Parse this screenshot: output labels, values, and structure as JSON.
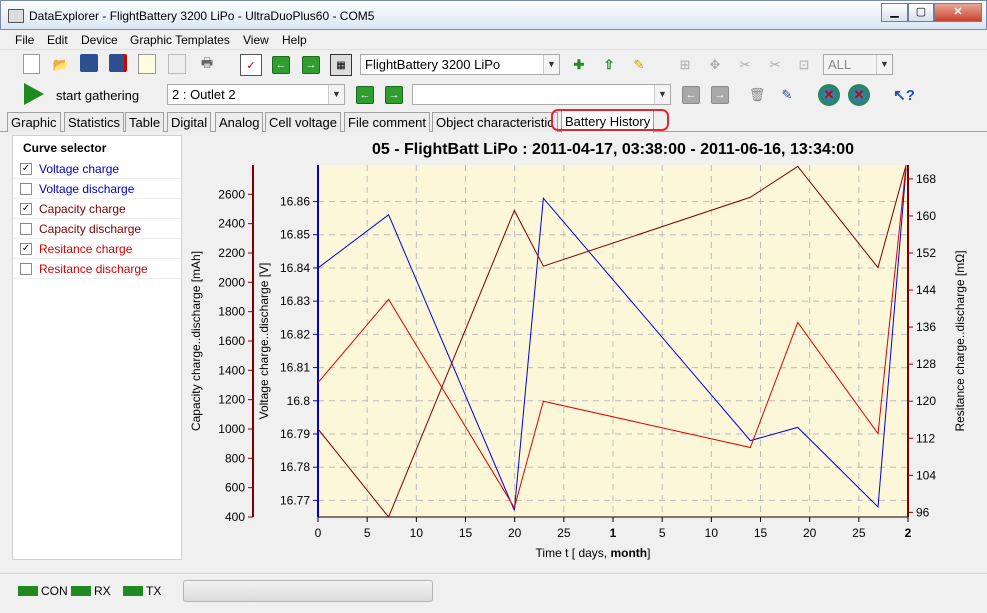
{
  "window": {
    "title": "DataExplorer  -  FlightBattery 3200 LiPo  -  UltraDuoPlus60  -  COM5"
  },
  "menu": [
    "File",
    "Edit",
    "Device",
    "Graphic Templates",
    "View",
    "Help"
  ],
  "toolbar": {
    "device_config": "FlightBattery 3200 LiPo",
    "filter": "ALL",
    "start_label": "start gathering",
    "outlet": "2 : Outlet 2",
    "record": ""
  },
  "tabs": [
    "Graphic",
    "Statistics",
    "Table",
    "Digital",
    "Analog",
    "Cell voltage",
    "File comment",
    "Object characteristic",
    "Battery History"
  ],
  "active_tab": "Battery History",
  "curve_selector": {
    "title": "Curve selector",
    "items": [
      {
        "label": "Voltage charge",
        "checked": true,
        "color": "#0000c8"
      },
      {
        "label": "Voltage discharge",
        "checked": false,
        "color": "#0000c8"
      },
      {
        "label": "Capacity charge",
        "checked": true,
        "color": "#800000"
      },
      {
        "label": "Capacity discharge",
        "checked": false,
        "color": "#800000"
      },
      {
        "label": "Resitance charge",
        "checked": true,
        "color": "#d40000"
      },
      {
        "label": "Resitance discharge",
        "checked": false,
        "color": "#d40000"
      }
    ]
  },
  "status": {
    "con": "CON",
    "rx": "RX",
    "tx": "TX"
  },
  "chart_data": {
    "type": "line",
    "title": "05 - FlightBatt LiPo : 2011-04-17, 03:38:00 - 2011-06-16, 13:34:00",
    "xlabel": "Time  t  [ days, month]",
    "x_ticks": [
      "0",
      "5",
      "10",
      "15",
      "20",
      "25",
      "1",
      "5",
      "10",
      "15",
      "20",
      "25",
      "2"
    ],
    "x_bold_ticks": [
      "1",
      "2"
    ],
    "x_bold_label_part": "month",
    "x_range": [
      0,
      61
    ],
    "grid": true,
    "axes": [
      {
        "id": "capacity",
        "label": "Capacity charge..discharge  [mAh]",
        "side": "left-outer",
        "color": "#800000",
        "min": 400,
        "max": 2800,
        "ticks": [
          400,
          600,
          800,
          1000,
          1200,
          1400,
          1600,
          1800,
          2000,
          2200,
          2400,
          2600
        ]
      },
      {
        "id": "voltage",
        "label": "Voltage charge..discharge  [V]",
        "side": "left-inner",
        "color": "#0000c8",
        "min": 16.765,
        "max": 16.871,
        "ticks": [
          16.77,
          16.78,
          16.79,
          16.8,
          16.81,
          16.82,
          16.83,
          16.84,
          16.85,
          16.86
        ]
      },
      {
        "id": "resistance",
        "label": "Resitance charge..discharge  [mΩ]",
        "side": "right",
        "color": "#800000",
        "min": 95,
        "max": 171,
        "ticks": [
          96,
          104,
          112,
          120,
          128,
          136,
          144,
          152,
          160,
          168
        ]
      }
    ],
    "series": [
      {
        "name": "Voltage charge",
        "axis": "voltage",
        "color": "#0000e0",
        "x": [
          0,
          7.3,
          20.3,
          23.3,
          44.7,
          49.6,
          57.9,
          60.8
        ],
        "y": [
          16.84,
          16.856,
          16.767,
          16.861,
          16.788,
          16.792,
          16.768,
          16.87
        ]
      },
      {
        "name": "Capacity charge",
        "axis": "capacity",
        "color": "#800000",
        "x": [
          0,
          7.3,
          20.3,
          23.3,
          44.7,
          49.6,
          57.9,
          60.8
        ],
        "y": [
          1000,
          400,
          2490,
          2110,
          2580,
          2790,
          2100,
          2800
        ]
      },
      {
        "name": "Resitance charge",
        "axis": "resistance",
        "color": "#e00000",
        "x": [
          0,
          7.3,
          20.3,
          23.3,
          44.7,
          49.6,
          57.9,
          60.8
        ],
        "y": [
          124,
          142,
          97,
          120,
          110,
          137,
          113,
          171
        ]
      }
    ]
  }
}
